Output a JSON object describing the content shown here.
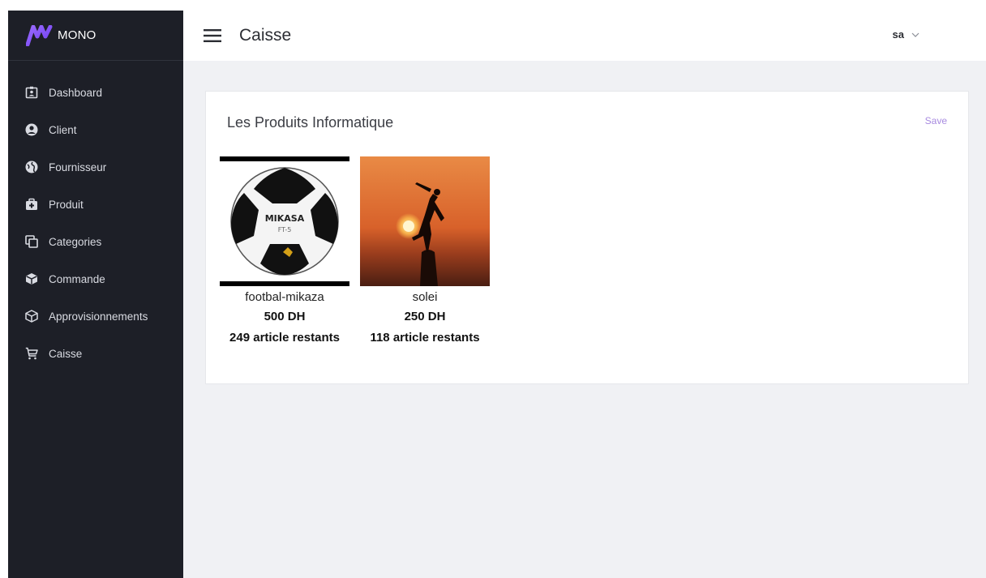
{
  "brand": {
    "name": "MONO",
    "accent": "#8b5cf6"
  },
  "sidebar": {
    "items": [
      {
        "label": "Dashboard",
        "icon": "id-badge-icon"
      },
      {
        "label": "Client",
        "icon": "user-circle-icon"
      },
      {
        "label": "Fournisseur",
        "icon": "globe-icon"
      },
      {
        "label": "Produit",
        "icon": "medkit-icon"
      },
      {
        "label": "Categories",
        "icon": "clone-icon"
      },
      {
        "label": "Commande",
        "icon": "cube-icon"
      },
      {
        "label": "Approvisionnements",
        "icon": "box-icon"
      },
      {
        "label": "Caisse",
        "icon": "cart-icon"
      }
    ]
  },
  "header": {
    "title": "Caisse",
    "user": "sa"
  },
  "card": {
    "title": "Les Produits Informatique",
    "save_label": "Save",
    "products": [
      {
        "name": "footbal-mikaza",
        "price": "500 DH",
        "stock": "249 article restants",
        "image": "soccer-ball-image",
        "brand_text": "MIKASA",
        "model_text": "FT-5"
      },
      {
        "name": "solei",
        "price": "250 DH",
        "stock": "118 article restants",
        "image": "sunset-silhouette-image"
      }
    ]
  },
  "colors": {
    "sidebar_bg": "#1d1f27",
    "content_bg": "#f0f1f4",
    "save_link": "#a88be0"
  }
}
